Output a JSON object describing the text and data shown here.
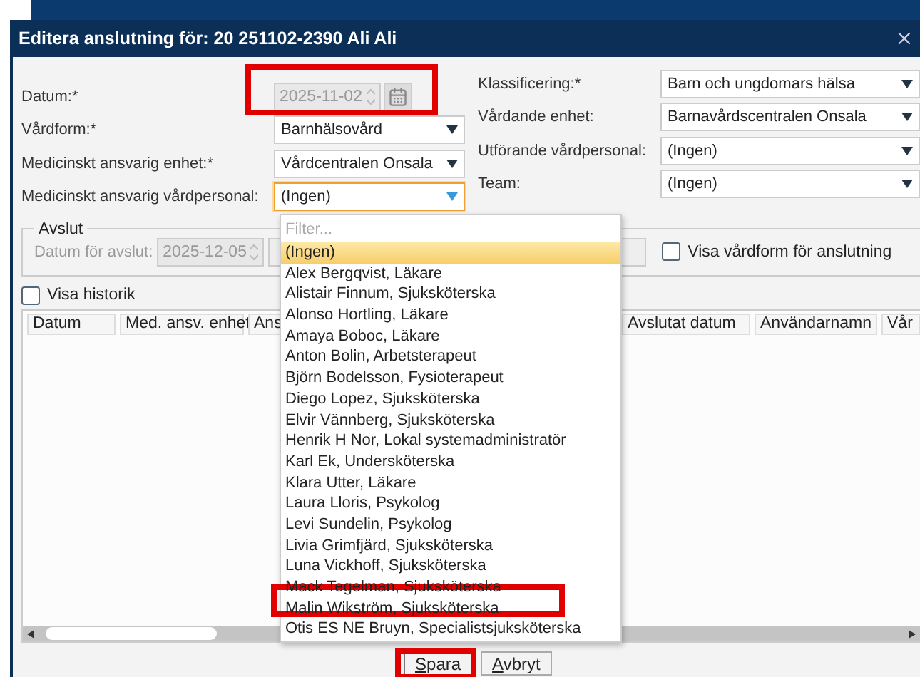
{
  "window": {
    "title": "Editera anslutning för: 20 251102-2390 Ali Ali"
  },
  "left_fields": [
    {
      "label": "Datum:*",
      "kind": "date",
      "value": "2025-11-02",
      "disabled": true
    },
    {
      "label": "Vårdform:*",
      "kind": "select",
      "value": "Barnhälsovård",
      "focused": false
    },
    {
      "label": "Medicinskt ansvarig enhet:*",
      "kind": "select",
      "value": "Vårdcentralen Onsala",
      "focused": false
    },
    {
      "label": "Medicinskt ansvarig vårdpersonal:",
      "kind": "select",
      "value": "(Ingen)",
      "focused": true
    }
  ],
  "right_fields": [
    {
      "label": "Klassificering:*",
      "kind": "select",
      "value": "Barn och ungdomars hälsa",
      "focused": false
    },
    {
      "label": "Vårdande enhet:",
      "kind": "select",
      "value": "Barnavårdscentralen Onsala",
      "focused": false
    },
    {
      "label": "Utförande vårdpersonal:",
      "kind": "select",
      "value": "(Ingen)",
      "focused": false
    },
    {
      "label": "Team:",
      "kind": "select",
      "value": "(Ingen)",
      "focused": false
    }
  ],
  "avslut": {
    "legend": "Avslut",
    "label": "Datum för avslut:",
    "value": "2025-12-05",
    "disabled": true,
    "checkbox": {
      "label": "Visa vårdform för anslutning",
      "checked": false
    }
  },
  "history_checkbox": {
    "label": "Visa historik",
    "checked": false
  },
  "table": {
    "columns": [
      "Datum",
      "Med. ansv. enhet",
      "Ans",
      "Avslutat datum",
      "Användarnamn",
      "Vår"
    ]
  },
  "dropdown": {
    "placeholder": "Filter...",
    "options": [
      {
        "label": "(Ingen)",
        "selected": true
      },
      {
        "label": "Alex Bergqvist, Läkare",
        "selected": false
      },
      {
        "label": "Alistair Finnum, Sjuksköterska",
        "selected": false
      },
      {
        "label": "Alonso Hortling, Läkare",
        "selected": false
      },
      {
        "label": "Amaya Boboc, Läkare",
        "selected": false
      },
      {
        "label": "Anton Bolin, Arbetsterapeut",
        "selected": false
      },
      {
        "label": "Björn Bodelsson, Fysioterapeut",
        "selected": false
      },
      {
        "label": "Diego Lopez, Sjuksköterska",
        "selected": false
      },
      {
        "label": "Elvir Vännberg, Sjuksköterska",
        "selected": false
      },
      {
        "label": "Henrik H Nor, Lokal systemadministratör",
        "selected": false
      },
      {
        "label": "Karl Ek, Undersköterska",
        "selected": false
      },
      {
        "label": "Klara Utter, Läkare",
        "selected": false
      },
      {
        "label": "Laura Lloris, Psykolog",
        "selected": false
      },
      {
        "label": "Levi Sundelin, Psykolog",
        "selected": false
      },
      {
        "label": "Livia Grimfjärd, Sjuksköterska",
        "selected": false
      },
      {
        "label": "Luna Vickhoff, Sjuksköterska",
        "selected": false
      },
      {
        "label": "Mack Tegelman, Sjuksköterska",
        "selected": false
      },
      {
        "label": "Malin Wikström, Sjuksköterska",
        "selected": false
      },
      {
        "label": "Otis ES NE Bruyn, Specialistsjuksköterska",
        "selected": false
      }
    ]
  },
  "buttons": [
    {
      "label": "Spara",
      "default": true
    },
    {
      "label": "Avbryt",
      "default": false
    }
  ]
}
